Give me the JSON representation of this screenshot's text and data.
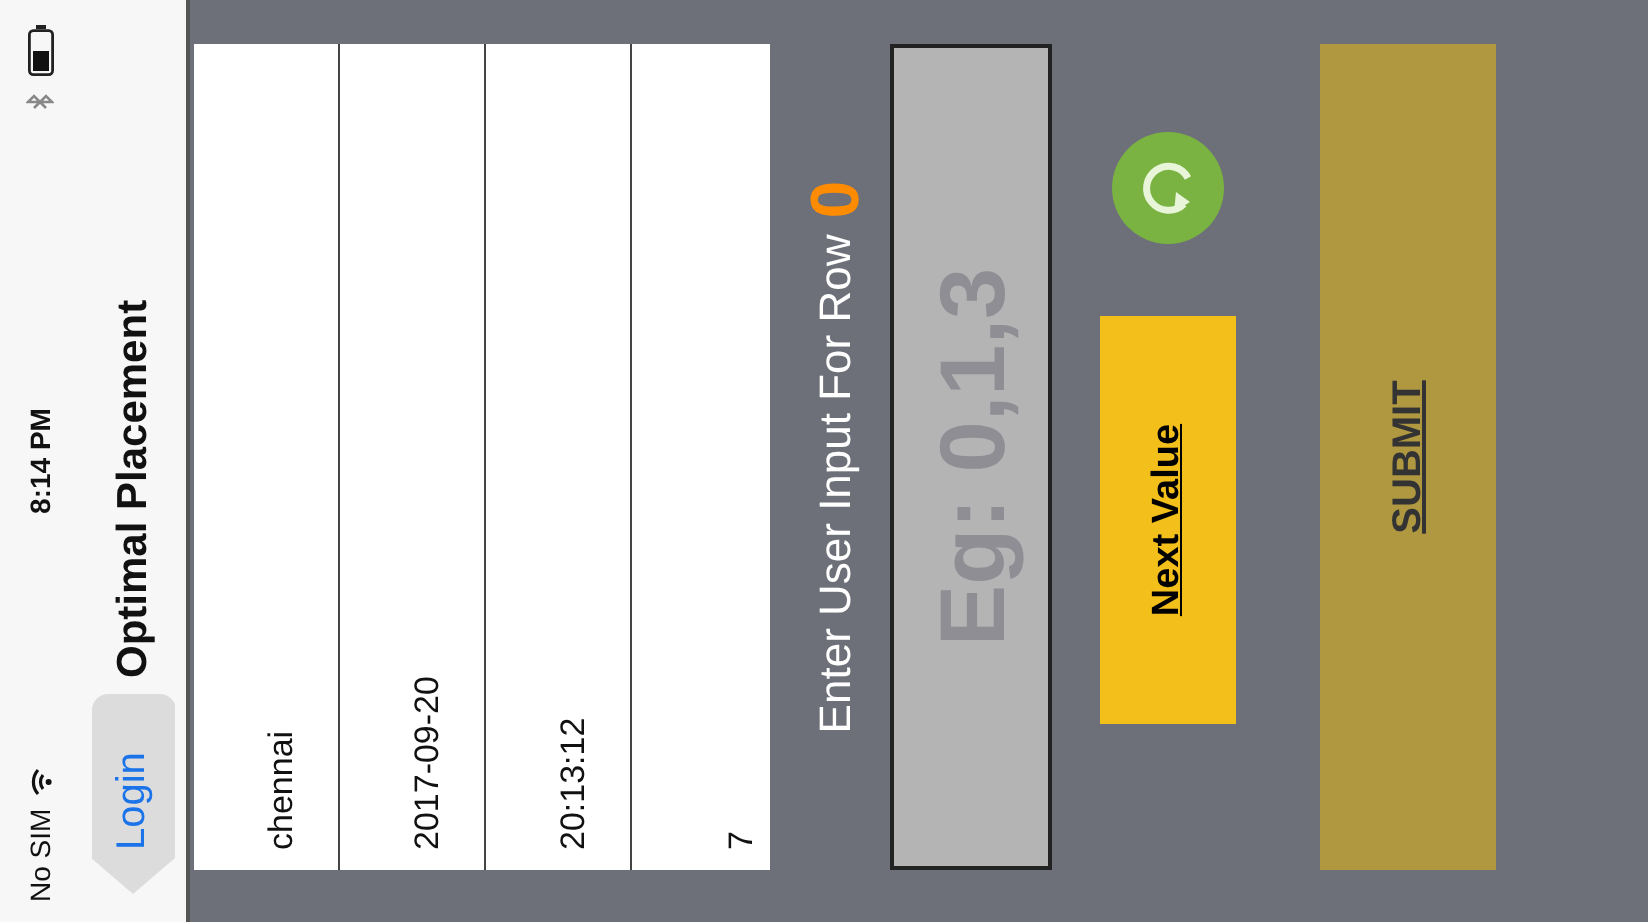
{
  "status_bar": {
    "carrier": "No SIM",
    "time": "8:14 PM"
  },
  "nav_bar": {
    "back_button": "Login",
    "title": "Optimal Placement"
  },
  "table": {
    "rows": [
      {
        "value": "chennai"
      },
      {
        "value": "2017-09-20"
      },
      {
        "value": "20:13:12"
      },
      {
        "value": "7"
      }
    ]
  },
  "prompt": {
    "text": "Enter User Input For Row",
    "row_number": "0"
  },
  "input": {
    "placeholder": "Eg: 0,1,3"
  },
  "buttons": {
    "next": "Next Value",
    "submit": "SUBMIT"
  }
}
